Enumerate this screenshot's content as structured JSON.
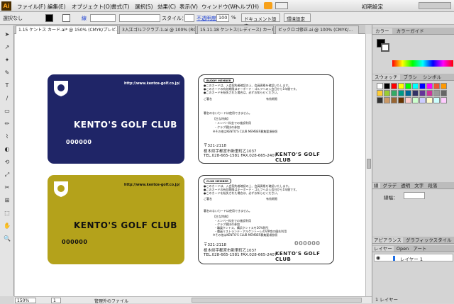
{
  "app": {
    "logo": "Ai"
  },
  "menu": [
    "ファイル(F)",
    "編集(E)",
    "オブジェクト(O)",
    "書式(T)",
    "選択(S)",
    "効果(C)",
    "表示(V)",
    "ウィンドウ(W)",
    "ヘルプ(H)"
  ],
  "workspace": "初期設定",
  "control": {
    "selection": "選択なし",
    "stroke_label": "線",
    "style_label": "スタイル：",
    "opacity_label": "不透明度",
    "opacity": "100",
    "pct": "%",
    "doc_setup": "ドキュメント設定",
    "env_setup": "環境設定"
  },
  "tabs": [
    "1.15  ケントス  カード.ai* @ 150% (CMYK/プレビュー)",
    "3入江ゴルフクラブ-1.ai @ 100% (RGB/...",
    "15.11.18  ケントス(レディース)  カード.ai...",
    "ビックロゴ修正.ai @ 100% (CMYK/..."
  ],
  "panels": {
    "color_tab": "カラー",
    "guide_tab": "カラーガイド",
    "swatch_tab": "スウォッチ",
    "brush_tab": "ブラシ",
    "symbol_tab": "シンボル",
    "stroke_tab": "線",
    "gradient_tab": "グラデ",
    "transparency_tab": "透明",
    "char_tab": "文字",
    "para_tab": "段落",
    "opentype_tab": "Open",
    "stroke_weight_label": "線幅：",
    "appearance_tab": "アピアランス",
    "graphic_style_tab": "グラフィックスタイル",
    "layers_tab": "レイヤー",
    "artboard_tab": "アート",
    "layer_name": "レイヤー 1",
    "layer_count": "1 レイヤー"
  },
  "status": {
    "zoom": "150%",
    "page": "1",
    "info": "管理外のファイル"
  },
  "cards": {
    "url": "http://www.kentos-golf.co.jp/",
    "brand": "KENTO'S GOLF CLUB",
    "number": "000000",
    "buddy_title": "BUDDY MEMBER",
    "club_title": "CLUB MEMBER",
    "rules": [
      "●このカードは、入会契約者確認の上、会員資格を確認いたします。",
      "●このカードの有効期限はキーボード・ゴルフへの入会日から1年間です。",
      "●このカードを紛失された場合は、必ずお知らせください。"
    ],
    "valid_label": "ご署名",
    "valid_until": "有効期限",
    "note": "署名のないカードは使用できません。",
    "benefits_title": "【主な特典】",
    "buddy_benefits": [
      "・メンバー料金での施設利用",
      "・クラブ競技の参加",
      "※その他はKENTO'S CLUB MEMBER募集要項参照"
    ],
    "club_benefits": [
      "・メンバー料金での施設利用",
      "・クラブ競技の参加",
      "・職員ケントス、構浜ケントスを20%割引",
      "・職員リストランテ・アルケントーレのVIP席の優先利用",
      "※その他はKENTO'S CLUB MEMBER募集要項参照"
    ],
    "zip": "〒321-2118",
    "address": "栃木県宇都宮市新里町乙1037",
    "tel": "TEL.028-665-1581   FAX.028-665-2407"
  }
}
